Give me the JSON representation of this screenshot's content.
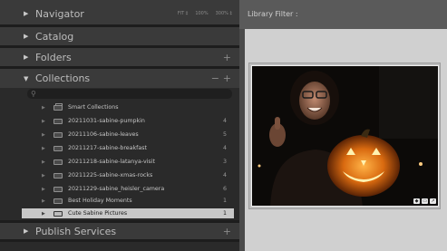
{
  "navigator": {
    "title": "Navigator",
    "options": [
      "FIT ‡",
      "100%",
      "300% ‡"
    ]
  },
  "catalog": {
    "title": "Catalog"
  },
  "folders": {
    "title": "Folders",
    "add": "+"
  },
  "collections": {
    "title": "Collections",
    "minus": "−",
    "add": "+",
    "items": [
      {
        "label": "Smart Collections",
        "count": "",
        "icon": "smart-collection-set-icon"
      },
      {
        "label": "20211031-sabine-pumpkin",
        "count": "4",
        "icon": "collection-icon"
      },
      {
        "label": "20211106-sabine-leaves",
        "count": "5",
        "icon": "collection-icon"
      },
      {
        "label": "20211217-sabine-breakfast",
        "count": "4",
        "icon": "collection-icon"
      },
      {
        "label": "20211218-sabine-latanya-visit",
        "count": "3",
        "icon": "collection-icon"
      },
      {
        "label": "20211225-sabine-xmas-rocks",
        "count": "4",
        "icon": "collection-icon"
      },
      {
        "label": "20211229-sabine_heisler_camera",
        "count": "6",
        "icon": "collection-icon"
      },
      {
        "label": "Best Holiday Moments",
        "count": "1",
        "icon": "collection-icon"
      },
      {
        "label": "Cute Sabine Pictures",
        "count": "1",
        "icon": "collection-icon",
        "selected": true
      }
    ]
  },
  "publish": {
    "title": "Publish Services",
    "add": "+"
  },
  "library_filter": "Library Filter :",
  "photo": {
    "badges": [
      "◆",
      "▭",
      "↗"
    ]
  },
  "colors": {
    "panel": "#2a2a2a",
    "header": "#3a3a3a",
    "selected_row": "#c8c8c8",
    "grid": "#d0d0d0"
  }
}
